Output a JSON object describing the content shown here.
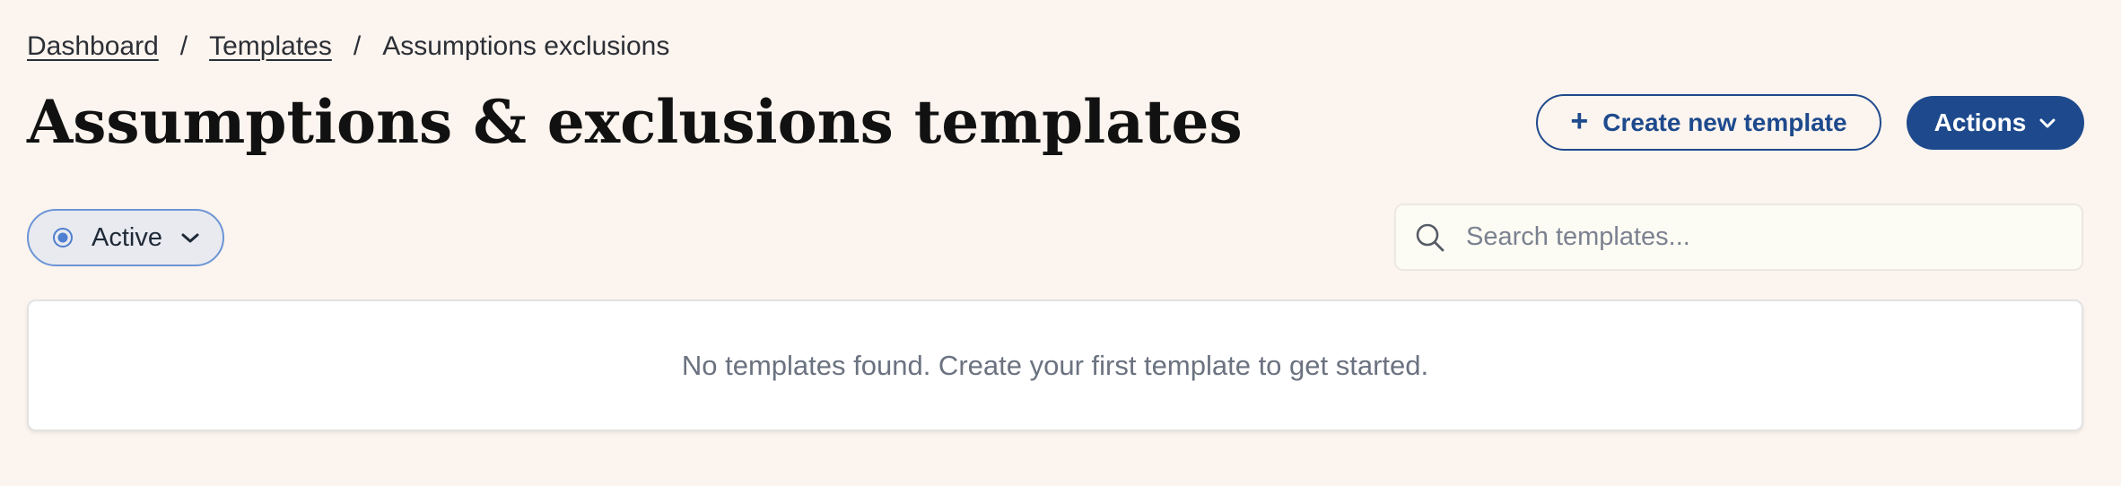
{
  "breadcrumb": {
    "items": [
      {
        "label": "Dashboard"
      },
      {
        "label": "Templates"
      }
    ],
    "separator": "/",
    "current": "Assumptions exclusions"
  },
  "page": {
    "title": "Assumptions & exclusions templates"
  },
  "actions": {
    "create_label": "Create new template",
    "create_icon": "plus-icon",
    "actions_label": "Actions",
    "actions_icon": "chevron-down-icon"
  },
  "filter": {
    "status_label": "Active",
    "status_icon": "radio-selected-icon"
  },
  "search": {
    "placeholder": "Search templates...",
    "value": ""
  },
  "empty_state": {
    "message": "No templates found. Create your first template to get started."
  },
  "colors": {
    "background": "#fcf4ee",
    "accent": "#1e4a8d",
    "filter_border": "#6c95d6",
    "muted_text": "#6b7280"
  }
}
